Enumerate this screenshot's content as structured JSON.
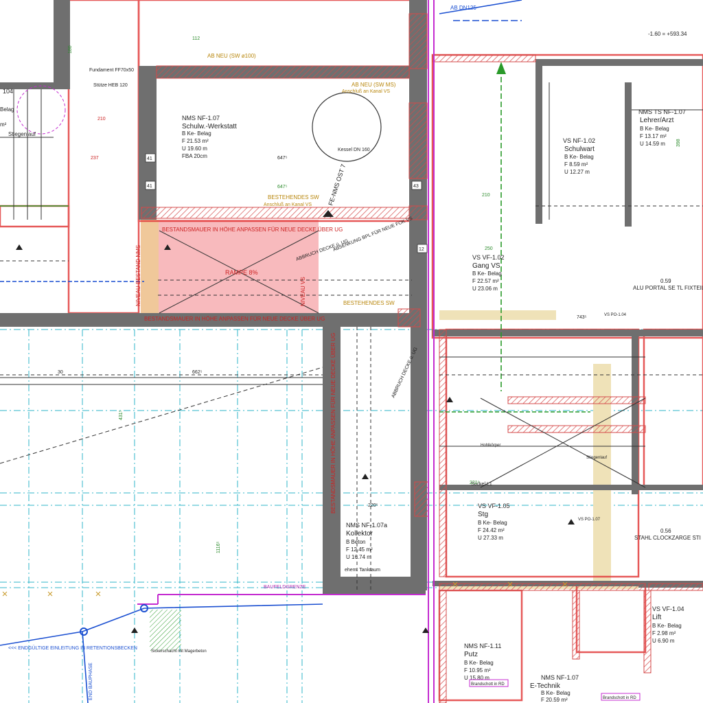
{
  "colors": {
    "wall_dark": "#6f6f6f",
    "wall_red": "#e23b3b",
    "hatch_red": "#d44a4a",
    "pink_fill": "#f7b3b6",
    "orange_fill": "#f0c89a",
    "beige_fill": "#efe2b8",
    "grid_cyan": "#2fb6c9",
    "magenta": "#c42bd0",
    "green": "#2a9a2a",
    "blue": "#1a4fd1",
    "black": "#222222"
  },
  "rooms": [
    {
      "name": "NMS NF-1.07",
      "title": "Schulw.-Werkstatt",
      "lines": [
        "B Ke- Belag",
        "F 21.53 m²",
        "U 19.60 m",
        "FBA 20cm"
      ]
    },
    {
      "name": "VS NF-1.02",
      "title": "Schulwart",
      "lines": [
        "B Ke- Belag",
        "F 8.59 m²",
        "U 12.27 m"
      ]
    },
    {
      "name": "NMS TS NF-1.07",
      "title": "Lehrer/Arzt",
      "lines": [
        "B Ke- Belag",
        "F 13.17 m²",
        "U 14.59 m"
      ]
    },
    {
      "name": "VS VF-1.02",
      "title": "Gang VS",
      "lines": [
        "B Ke- Belag",
        "F 22.57 m²",
        "U 23.06 m"
      ]
    },
    {
      "name": "VS VF-1.05",
      "title": "Stg",
      "lines": [
        "B Ke- Belag",
        "F 24.42 m²",
        "U 27.33 m"
      ]
    },
    {
      "name": "NMS NF-1.07a",
      "title": "Kollektor",
      "lines": [
        "B Beton",
        "F 12.45 m²",
        "U 16.74 m"
      ]
    },
    {
      "name": "NMS NF-1.11",
      "title": "Putz",
      "lines": [
        "B Ke- Belag",
        "F 10.95 m²",
        "U 15.80 m"
      ]
    },
    {
      "name": "VS VF-1.04",
      "title": "Lift",
      "lines": [
        "B Ke- Belag",
        "F 2.98 m²",
        "U 6.90 m"
      ]
    },
    {
      "name": "NMS NF-1.07",
      "title": "E-Technik",
      "lines": [
        "B Ke- Belag",
        "F 20.59 m²"
      ]
    }
  ],
  "notes": {
    "wall_note_1": "BESTANDSMAUER IN HÖHE ANPASSEN FÜR NEUE DECKE ÜBER UG",
    "wall_note_2": "BESTANDSMAUER IN HÖHE ANPASSEN FÜR NEUE DECKE ÜBER UG",
    "wall_note_3": "BESTANDSMAUER IN HÖHE ANPASSEN FÜR NEUE DECKE ÜBER UG",
    "rampe": "RAMPE 8%",
    "niveau_1": "NIVEAU BESTAND NMS",
    "niveau_2": "NIVEAU VS",
    "bestehendes_sw": "BESTEHENDES SW",
    "anschluss_kanal": "Anschluß an Kanal VS",
    "ab_neu_sw": "AB NEU (SW MS)",
    "ab_neu_top": "AB NEU (SW ø100)",
    "ab_dn125": "AB DN125",
    "bestehendes_sw_2": "BESTEHENDES SW",
    "fe_nms": "FE-NMS OST 7",
    "kessel": "Kessel DN 160",
    "abbruch_1": "ABBRUCH DECKE ü. UG",
    "abbruch_2": "ABBRUCH DECKE ü. UG",
    "absenkung": "ABSENKUNG BPL FÜR NEUE FOK VS",
    "baufelddgrenze": "BAUFELDGRENZE",
    "endgueltige": "<<< ENDGÜLTIGE EINLEITUNG IN RETENTIONSBECKEN",
    "sickerschacht": "Sickerschacht mit Magerbeton",
    "end_bauphase": "END BAUPHASE",
    "alu_portal": "ALU PORTAL SE TL FIXTEIL",
    "alu_portal_num": "0.59",
    "stahl_portal": "STAHL CLOCKZARGE STI",
    "stahl_portal_num": "0.56",
    "fundament": "Fundament FF70x50",
    "stuetze": "Stütze HEB 120",
    "hohlkoerper": "Hohlkörper",
    "sockel": "Sockel L1",
    "brandschott": "Brandschott in RD",
    "brandschott_2": "Brandschott in RD",
    "ehem_tankraum": "ehem. Tankraum",
    "stiegenlauf": "Stiegenlauf",
    "kote_top_right": "-1.60 = +593.34",
    "stahl_ref_1": "VS PO-1.04",
    "stahl_ref_2": "VS PO-1.07"
  },
  "dims": {
    "d_647a": "647⁵",
    "d_647b": "647⁵",
    "d_662": "662⁵",
    "d_180": "180",
    "d_237": "237",
    "d_210": "210",
    "d_220": "220⁵",
    "d_1116": "1116⁵",
    "d_431": "431⁵",
    "d_112": "112",
    "d_388": "398",
    "d_250": "250",
    "d_210b": "210",
    "d_221": "221⁵",
    "d_743": "743⁵"
  },
  "axis_marks": {
    "m_41a": "41",
    "m_41b": "41",
    "m_43": "43",
    "m_12": "12",
    "m_30": "30"
  },
  "partial_labels": {
    "left_room": "104",
    "left_belag": "Belag",
    "left_m2": "m²",
    "left_stieg": "Stiegenlauf"
  }
}
